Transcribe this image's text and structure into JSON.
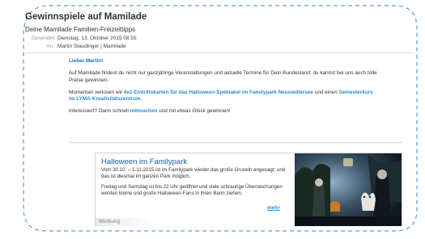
{
  "email": {
    "subject": "Gewinnspiele auf Mamilade",
    "sender_display": "Deine Mamilade Familien-Freizeittipps",
    "sent_label": "Gesendet:",
    "sent_value": "Dienstag, 13. Oktober 2015 08:55",
    "to_label": "An:",
    "to_value": "Martin Staudinger | Mamilade"
  },
  "body": {
    "greeting": "Lieber Martin!",
    "p1": "Auf Mamilade findest du nicht nur ganzjährige Veranstaltungen und aktuelle Termine für Dein Bundesland; du kannst bei uns auch tolle Preise gewinnen.",
    "p2_pre": "Momentan verlosen wir ",
    "p2_link1": "4x2 Eintrittskarten für das Halloween-Spektakel im Familypark Neusiedlersee",
    "p2_mid": " und einen ",
    "p2_link2": "Semesterkurs im LYMA-Kreativitätszentrum",
    "p2_post": ".",
    "p3_pre": "Interessiert? Dann schnell ",
    "p3_link": "mitmachen",
    "p3_post": " und mit etwas Glück gewinnen!"
  },
  "ad": {
    "title": "Halloween im Familypark",
    "text1": "Vom 30.10. – 1.11.2015 ist im Familypark wieder das große Gruseln angesagt; und das ist diesmal im ganzen Park möglich.",
    "text2": "Freitag und Samstag ist bis 22 Uhr geöffnet und viele schraurige Überraschungen werden kleine und große Halloween-Fans in ihren Bann ziehen.",
    "more": "mehr",
    "badge": "Werbung"
  },
  "colors": {
    "accent": "#2a8ad8",
    "heading_blue": "#1a5c9e",
    "frame_dash": "#5b9bd5"
  }
}
